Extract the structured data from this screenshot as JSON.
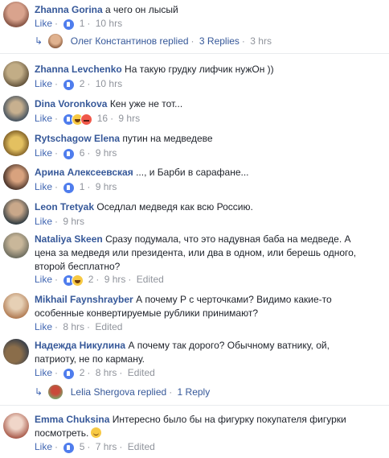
{
  "comments": [
    {
      "name": "Zhanna Gorina",
      "text": "а чего он лысый",
      "like": "Like",
      "reactions": "1",
      "time": "10 hrs",
      "edited": "",
      "avatar_color": "#d9a38d",
      "avatar_color2": "#8c5a4a"
    },
    {
      "name": "Zhanna Levchenko",
      "text": "На такую грудку лифчик нужОн ))",
      "like": "Like",
      "reactions": "2",
      "time": "10 hrs",
      "edited": "",
      "avatar_color": "#9c8a6a",
      "avatar_color2": "#5e4f38"
    },
    {
      "name": "Dina Voronkova",
      "text": "Кен уже не тот...",
      "like": "Like",
      "reactions": "16",
      "time": "9 hrs",
      "edited": "",
      "avatar_color": "#4a5661",
      "avatar_color2": "#b6a287"
    },
    {
      "name": "Rytschagow Elena",
      "text": "путин на медведеве",
      "like": "Like",
      "reactions": "6",
      "time": "9 hrs",
      "edited": "",
      "avatar_color": "#cda23a",
      "avatar_color2": "#6e4f1d"
    },
    {
      "name": "Арина Алексеевская",
      "text": "..., и Барби в сарафане...",
      "like": "Like",
      "reactions": "1",
      "time": "9 hrs",
      "edited": "",
      "avatar_color": "#a06a4e",
      "avatar_color2": "#3d2a22"
    },
    {
      "name": "Leon Tretyak",
      "text": "Оседлал медведя как всю Россию.",
      "like": "Like",
      "reactions": "",
      "time": "9 hrs",
      "edited": "",
      "avatar_color": "#7c8990",
      "avatar_color2": "#2e3a40"
    },
    {
      "name": "Nataliya Skeen",
      "text": "Сразу подумала, что это надувная баба на медведе. А цена за медведя или президента, или два в одном, или берешь одного, второй бесплатно?",
      "like": "Like",
      "reactions": "2",
      "time": "9 hrs",
      "edited": "Edited",
      "avatar_color": "#6c6c5e",
      "avatar_color2": "#c9b79a"
    },
    {
      "name": "Mikhail Faynshrayber",
      "text": "А почему Р с черточками? Видимо какие-то особенные конвертируемые рублики принимают?",
      "like": "Like",
      "reactions": "",
      "time": "8 hrs",
      "edited": "Edited",
      "avatar_color": "#b07a52",
      "avatar_color2": "#e6d0b5"
    },
    {
      "name": "Надежда Никулина",
      "text": "А почему так дорого? Обычному ватнику, ой, патриоту, не по карману.",
      "like": "Like",
      "reactions": "2",
      "time": "8 hrs",
      "edited": "Edited",
      "avatar_color": "#8a6d4a",
      "avatar_color2": "#2f3a4a"
    },
    {
      "name": "Emma Chuksina",
      "text": "Интересно было бы на фигурку покупателя фигурки посмотреть.",
      "like": "Like",
      "reactions": "5",
      "time": "7 hrs",
      "edited": "Edited",
      "avatar_color": "#a85a4a",
      "avatar_color2": "#f0d6c9"
    }
  ],
  "replies": [
    {
      "name": "Олег Константинов",
      "replied": "replied",
      "count": "3 Replies",
      "time": "3 hrs",
      "avatar_color": "#b8805c"
    },
    {
      "name": "Lelia Shergova",
      "replied": "replied",
      "count": "1 Reply",
      "time": "",
      "avatar_color": "#7aa36a"
    }
  ],
  "icons": {
    "reply_arrow": "reply-arrow-icon"
  }
}
